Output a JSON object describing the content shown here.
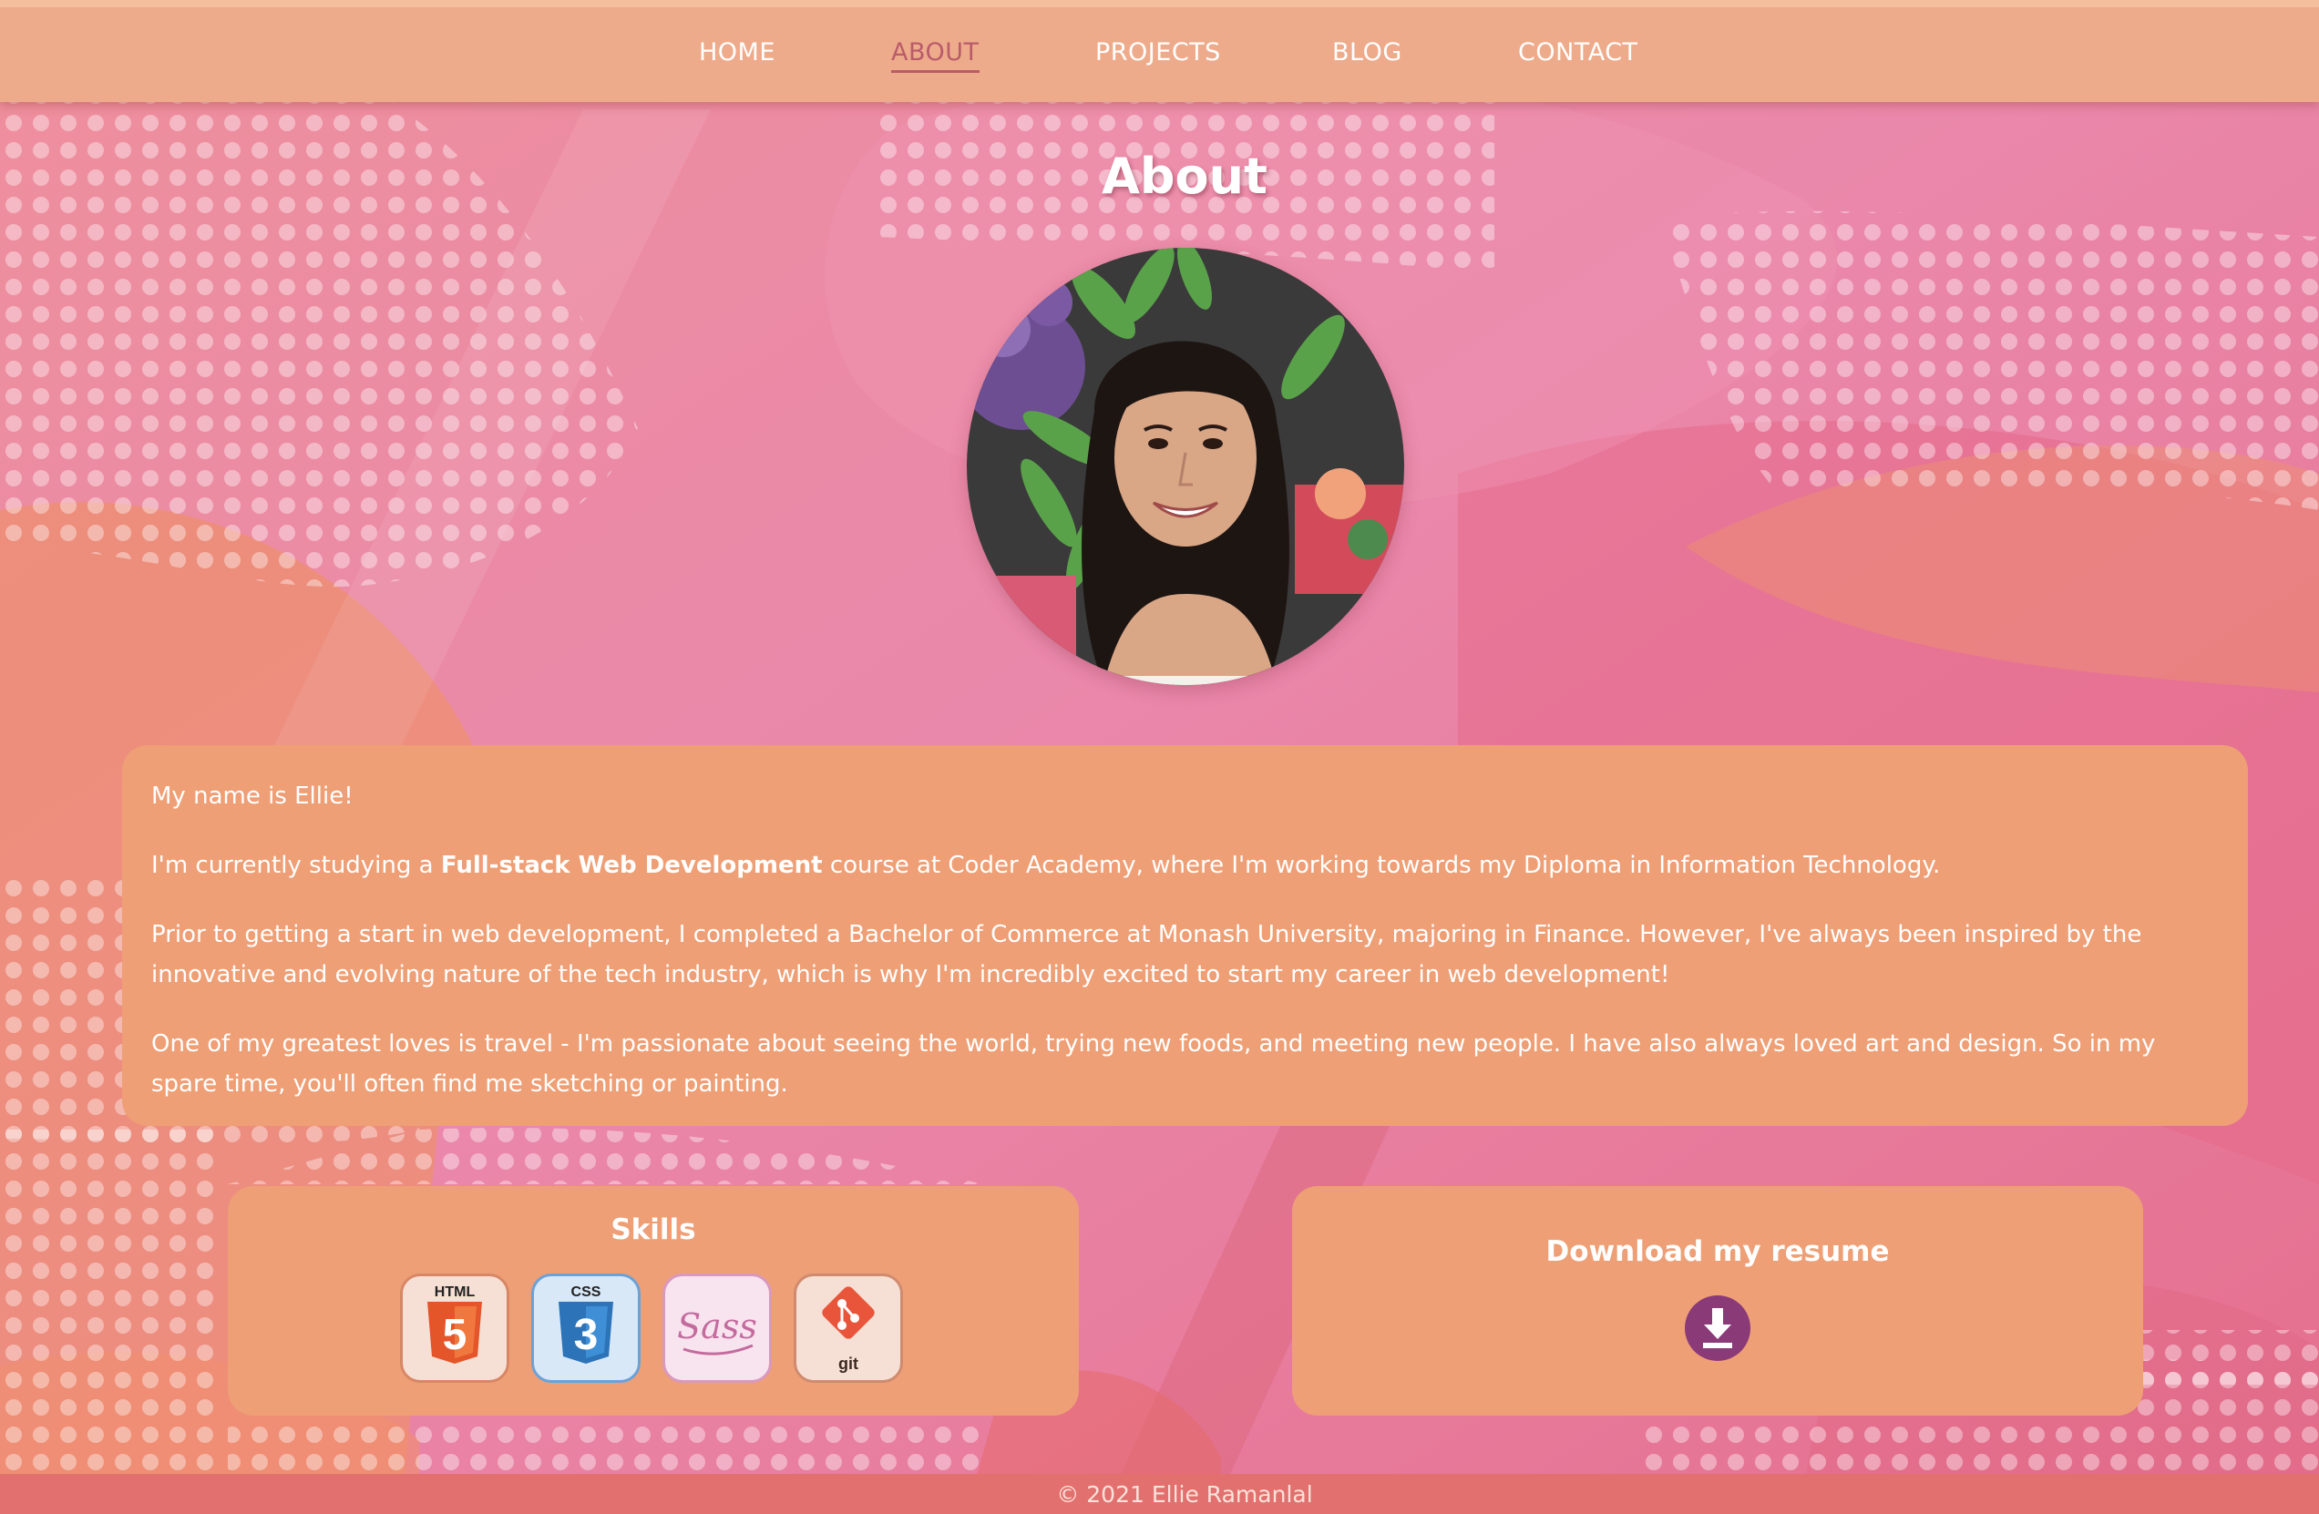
{
  "nav": {
    "items": [
      {
        "label": "HOME",
        "active": false
      },
      {
        "label": "ABOUT",
        "active": true
      },
      {
        "label": "PROJECTS",
        "active": false
      },
      {
        "label": "BLOG",
        "active": false
      },
      {
        "label": "CONTACT",
        "active": false
      }
    ]
  },
  "page": {
    "title": "About"
  },
  "about": {
    "intro": "My name is Ellie!",
    "para2_prefix": "I'm currently studying a ",
    "para2_bold": "Full-stack Web Development",
    "para2_suffix": " course at Coder Academy, where I'm working towards my Diploma in Information Technology.",
    "para3": "Prior to getting a start in web development, I completed a Bachelor of Commerce at Monash University, majoring in Finance. However, I've always been inspired by the innovative and evolving nature of the tech industry, which is why I'm incredibly excited to start my career in web development!",
    "para4": "One of my greatest loves is travel - I'm passionate about seeing the world, trying new foods, and meeting new people. I have also always loved art and design. So in my spare time, you'll often find me sketching or painting."
  },
  "skills": {
    "title": "Skills",
    "items": [
      {
        "name": "html5-icon",
        "label": "HTML",
        "glyph": "5",
        "color": "#e4562a",
        "tile": "#f6dfd4",
        "border": "#d88766"
      },
      {
        "name": "css3-icon",
        "label": "CSS",
        "glyph": "3",
        "color": "#2d73b8",
        "tile": "#d8e8f7",
        "border": "#6aa2d8"
      },
      {
        "name": "sass-icon",
        "label": "Sass",
        "glyph": "",
        "color": "#c46b9e",
        "tile": "#f8e4ef",
        "border": "#d998bf"
      },
      {
        "name": "git-icon",
        "label": "git",
        "glyph": "",
        "color": "#e8553a",
        "tile": "#f6dfd4",
        "border": "#cf8b6f"
      }
    ]
  },
  "resume": {
    "title": "Download my resume",
    "icon": "download-icon"
  },
  "footer": {
    "text": "© 2021 Ellie Ramanlal"
  },
  "colors": {
    "nav_bg": "#eeab8b",
    "nav_active": "#b95c6a",
    "card_bg": "#ee9f76",
    "download_btn": "#8b3a78",
    "footer_bg": "#e2706e"
  }
}
